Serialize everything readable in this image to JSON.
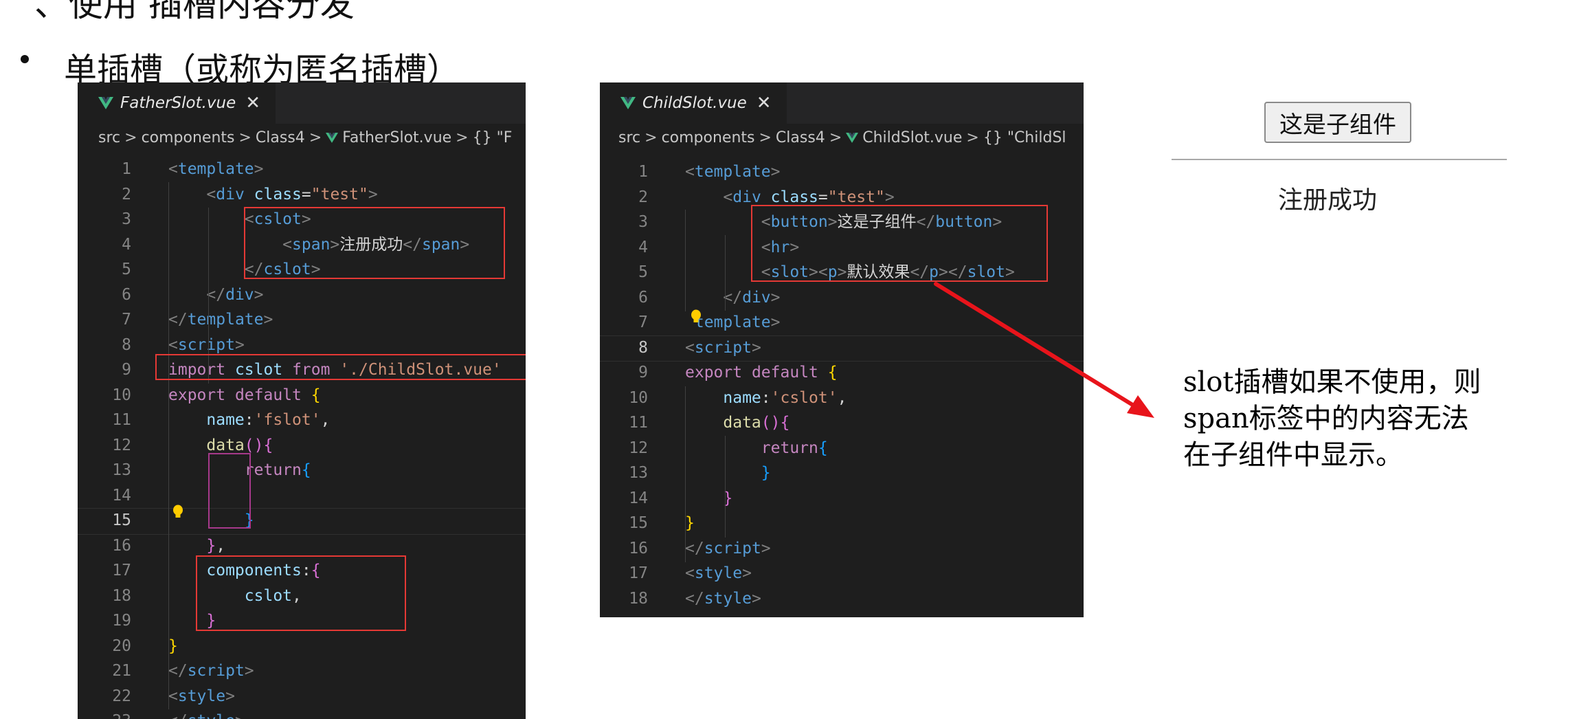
{
  "heading_partial": "、使用 插槽内容分发",
  "bullet_heading": "单插槽（或称为匿名插槽）",
  "father_editor": {
    "tab_title": "FatherSlot.vue",
    "close_glyph": "✕",
    "breadcrumb": [
      "src",
      "components",
      "Class4",
      "FatherSlot.vue",
      "{} \"F"
    ],
    "lines": [
      {
        "n": "1",
        "tokens": [
          [
            "t-brk",
            "<"
          ],
          [
            "t-tag",
            "template"
          ],
          [
            "t-brk",
            ">"
          ]
        ]
      },
      {
        "n": "2",
        "tokens": [
          [
            "t-txt",
            "    "
          ],
          [
            "t-brk",
            "<"
          ],
          [
            "t-tag",
            "div"
          ],
          [
            "t-txt",
            " "
          ],
          [
            "t-attr",
            "class"
          ],
          [
            "t-txt",
            "="
          ],
          [
            "t-str",
            "\"test\""
          ],
          [
            "t-brk",
            ">"
          ]
        ]
      },
      {
        "n": "3",
        "tokens": [
          [
            "t-txt",
            "        "
          ],
          [
            "t-brk",
            "<"
          ],
          [
            "t-tag",
            "cslot"
          ],
          [
            "t-brk",
            ">"
          ]
        ]
      },
      {
        "n": "4",
        "tokens": [
          [
            "t-txt",
            "            "
          ],
          [
            "t-brk",
            "<"
          ],
          [
            "t-tag",
            "span"
          ],
          [
            "t-brk",
            ">"
          ],
          [
            "t-txt",
            "注册成功"
          ],
          [
            "t-brk",
            "</"
          ],
          [
            "t-tag",
            "span"
          ],
          [
            "t-brk",
            ">"
          ]
        ]
      },
      {
        "n": "5",
        "tokens": [
          [
            "t-txt",
            "        "
          ],
          [
            "t-brk",
            "</"
          ],
          [
            "t-tag",
            "cslot"
          ],
          [
            "t-brk",
            ">"
          ]
        ]
      },
      {
        "n": "6",
        "tokens": [
          [
            "t-txt",
            "    "
          ],
          [
            "t-brk",
            "</"
          ],
          [
            "t-tag",
            "div"
          ],
          [
            "t-brk",
            ">"
          ]
        ]
      },
      {
        "n": "7",
        "tokens": [
          [
            "t-brk",
            "</"
          ],
          [
            "t-tag",
            "template"
          ],
          [
            "t-brk",
            ">"
          ]
        ]
      },
      {
        "n": "8",
        "tokens": [
          [
            "t-brk",
            "<"
          ],
          [
            "t-tag",
            "script"
          ],
          [
            "t-brk",
            ">"
          ]
        ]
      },
      {
        "n": "9",
        "tokens": [
          [
            "t-kw",
            "import"
          ],
          [
            "t-txt",
            " "
          ],
          [
            "t-attr",
            "cslot"
          ],
          [
            "t-txt",
            " "
          ],
          [
            "t-kw",
            "from"
          ],
          [
            "t-txt",
            " "
          ],
          [
            "t-str",
            "'./ChildSlot.vue'"
          ]
        ]
      },
      {
        "n": "10",
        "tokens": [
          [
            "t-kw",
            "export"
          ],
          [
            "t-txt",
            " "
          ],
          [
            "t-kw",
            "default"
          ],
          [
            "t-txt",
            " "
          ],
          [
            "t-brace1",
            "{"
          ]
        ]
      },
      {
        "n": "11",
        "tokens": [
          [
            "t-txt",
            "    "
          ],
          [
            "t-attr",
            "name"
          ],
          [
            "t-txt",
            ":"
          ],
          [
            "t-str",
            "'fslot'"
          ],
          [
            "t-txt",
            ","
          ]
        ]
      },
      {
        "n": "12",
        "tokens": [
          [
            "t-txt",
            "    "
          ],
          [
            "t-fn",
            "data"
          ],
          [
            "t-brace2",
            "()"
          ],
          [
            "t-brace2",
            "{"
          ]
        ]
      },
      {
        "n": "13",
        "tokens": [
          [
            "t-txt",
            "        "
          ],
          [
            "t-kw",
            "return"
          ],
          [
            "t-brace3",
            "{"
          ]
        ]
      },
      {
        "n": "14",
        "tokens": []
      },
      {
        "n": "15",
        "tokens": [
          [
            "t-txt",
            "        "
          ],
          [
            "t-brace3",
            "}"
          ]
        ]
      },
      {
        "n": "16",
        "tokens": [
          [
            "t-txt",
            "    "
          ],
          [
            "t-brace2",
            "}"
          ],
          [
            "t-txt",
            ","
          ]
        ]
      },
      {
        "n": "17",
        "tokens": [
          [
            "t-txt",
            "    "
          ],
          [
            "t-attr",
            "components"
          ],
          [
            "t-txt",
            ":"
          ],
          [
            "t-brace2",
            "{"
          ]
        ]
      },
      {
        "n": "18",
        "tokens": [
          [
            "t-txt",
            "        "
          ],
          [
            "t-attr",
            "cslot"
          ],
          [
            "t-txt",
            ","
          ]
        ]
      },
      {
        "n": "19",
        "tokens": [
          [
            "t-txt",
            "    "
          ],
          [
            "t-brace2",
            "}"
          ]
        ]
      },
      {
        "n": "20",
        "tokens": [
          [
            "t-brace1",
            "}"
          ]
        ]
      },
      {
        "n": "21",
        "tokens": [
          [
            "t-brk",
            "</"
          ],
          [
            "t-tag",
            "script"
          ],
          [
            "t-brk",
            ">"
          ]
        ]
      },
      {
        "n": "22",
        "tokens": [
          [
            "t-brk",
            "<"
          ],
          [
            "t-tag",
            "style"
          ],
          [
            "t-brk",
            ">"
          ]
        ]
      },
      {
        "n": "23",
        "tokens": [
          [
            "t-brk",
            "</"
          ],
          [
            "t-tag",
            "style"
          ],
          [
            "t-brk",
            ">"
          ]
        ]
      }
    ]
  },
  "child_editor": {
    "tab_title": "ChildSlot.vue",
    "close_glyph": "✕",
    "breadcrumb": [
      "src",
      "components",
      "Class4",
      "ChildSlot.vue",
      "{} \"ChildSl"
    ],
    "lines": [
      {
        "n": "1",
        "tokens": [
          [
            "t-brk",
            "<"
          ],
          [
            "t-tag",
            "template"
          ],
          [
            "t-brk",
            ">"
          ]
        ]
      },
      {
        "n": "2",
        "tokens": [
          [
            "t-txt",
            "    "
          ],
          [
            "t-brk",
            "<"
          ],
          [
            "t-tag",
            "div"
          ],
          [
            "t-txt",
            " "
          ],
          [
            "t-attr",
            "class"
          ],
          [
            "t-txt",
            "="
          ],
          [
            "t-str",
            "\"test\""
          ],
          [
            "t-brk",
            ">"
          ]
        ]
      },
      {
        "n": "3",
        "tokens": [
          [
            "t-txt",
            "        "
          ],
          [
            "t-brk",
            "<"
          ],
          [
            "t-tag",
            "button"
          ],
          [
            "t-brk",
            ">"
          ],
          [
            "t-txt",
            "这是子组件"
          ],
          [
            "t-brk",
            "</"
          ],
          [
            "t-tag",
            "button"
          ],
          [
            "t-brk",
            ">"
          ]
        ]
      },
      {
        "n": "4",
        "tokens": [
          [
            "t-txt",
            "        "
          ],
          [
            "t-brk",
            "<"
          ],
          [
            "t-tag",
            "hr"
          ],
          [
            "t-brk",
            ">"
          ]
        ]
      },
      {
        "n": "5",
        "tokens": [
          [
            "t-txt",
            "        "
          ],
          [
            "t-brk",
            "<"
          ],
          [
            "t-tag",
            "slot"
          ],
          [
            "t-brk",
            "><"
          ],
          [
            "t-tag",
            "p"
          ],
          [
            "t-brk",
            ">"
          ],
          [
            "t-txt",
            "默认效果"
          ],
          [
            "t-brk",
            "</"
          ],
          [
            "t-tag",
            "p"
          ],
          [
            "t-brk",
            "></"
          ],
          [
            "t-tag",
            "slot"
          ],
          [
            "t-brk",
            ">"
          ]
        ]
      },
      {
        "n": "6",
        "tokens": [
          [
            "t-txt",
            "    "
          ],
          [
            "t-brk",
            "</"
          ],
          [
            "t-tag",
            "div"
          ],
          [
            "t-brk",
            ">"
          ]
        ]
      },
      {
        "n": "7",
        "tokens": [
          [
            "t-txt",
            " "
          ],
          [
            "t-tag",
            "template"
          ],
          [
            "t-brk",
            ">"
          ]
        ]
      },
      {
        "n": "8",
        "tokens": [
          [
            "t-brk",
            "<"
          ],
          [
            "t-tag",
            "script"
          ],
          [
            "t-brk",
            ">"
          ]
        ]
      },
      {
        "n": "9",
        "tokens": [
          [
            "t-kw",
            "export"
          ],
          [
            "t-txt",
            " "
          ],
          [
            "t-kw",
            "default"
          ],
          [
            "t-txt",
            " "
          ],
          [
            "t-brace1",
            "{"
          ]
        ]
      },
      {
        "n": "10",
        "tokens": [
          [
            "t-txt",
            "    "
          ],
          [
            "t-attr",
            "name"
          ],
          [
            "t-txt",
            ":"
          ],
          [
            "t-str",
            "'cslot'"
          ],
          [
            "t-txt",
            ","
          ]
        ]
      },
      {
        "n": "11",
        "tokens": [
          [
            "t-txt",
            "    "
          ],
          [
            "t-fn",
            "data"
          ],
          [
            "t-brace2",
            "()"
          ],
          [
            "t-brace2",
            "{"
          ]
        ]
      },
      {
        "n": "12",
        "tokens": [
          [
            "t-txt",
            "        "
          ],
          [
            "t-kw",
            "return"
          ],
          [
            "t-brace3",
            "{"
          ]
        ]
      },
      {
        "n": "13",
        "tokens": [
          [
            "t-txt",
            "        "
          ],
          [
            "t-brace3",
            "}"
          ]
        ]
      },
      {
        "n": "14",
        "tokens": [
          [
            "t-txt",
            "    "
          ],
          [
            "t-brace2",
            "}"
          ]
        ]
      },
      {
        "n": "15",
        "tokens": [
          [
            "t-brace1",
            "}"
          ]
        ]
      },
      {
        "n": "16",
        "tokens": [
          [
            "t-brk",
            "</"
          ],
          [
            "t-tag",
            "script"
          ],
          [
            "t-brk",
            ">"
          ]
        ]
      },
      {
        "n": "17",
        "tokens": [
          [
            "t-brk",
            "<"
          ],
          [
            "t-tag",
            "style"
          ],
          [
            "t-brk",
            ">"
          ]
        ]
      },
      {
        "n": "18",
        "tokens": [
          [
            "t-brk",
            "</"
          ],
          [
            "t-tag",
            "style"
          ],
          [
            "t-brk",
            ">"
          ]
        ]
      }
    ]
  },
  "result": {
    "button_label": "这是子组件",
    "slot_text": "注册成功"
  },
  "annotation": {
    "lines": [
      "slot插槽如果不使用，则",
      "span标签中的内容无法",
      "在子组件中显示。"
    ]
  },
  "colors": {
    "editor_bg": "#1e1e1e",
    "highlight_box": "#e53935",
    "arrow": "#e8141b",
    "vue_green": "#41b883"
  },
  "icons": [
    "vue-file-icon",
    "lightbulb-icon",
    "arrow-annotation"
  ]
}
